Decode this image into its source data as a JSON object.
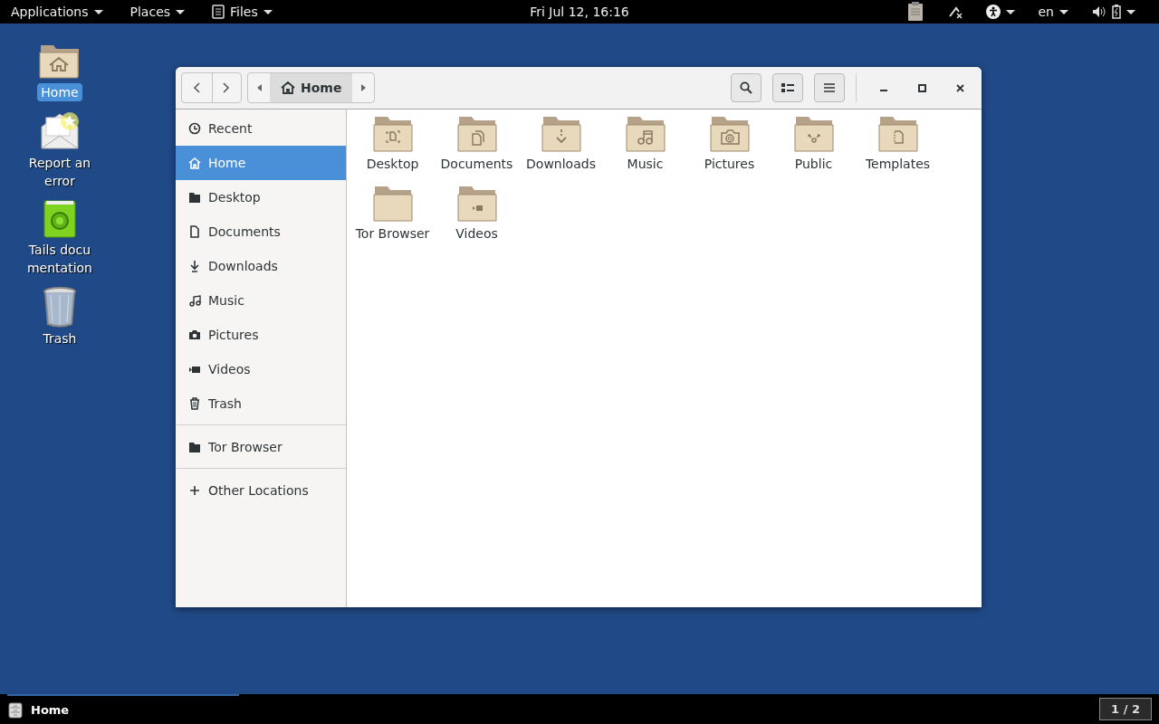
{
  "top_bar": {
    "menus": [
      {
        "label": "Applications",
        "kind": "menu"
      },
      {
        "label": "Places",
        "kind": "menu"
      },
      {
        "label": "Files",
        "kind": "app"
      }
    ],
    "clock": "Fri Jul 12, 16:16",
    "language": "en"
  },
  "desktop_icons": [
    {
      "label": "Home",
      "kind": "home",
      "selected": true
    },
    {
      "label": "Report an error",
      "kind": "report",
      "selected": false
    },
    {
      "label": "Tails documentation",
      "kind": "book",
      "selected": false
    },
    {
      "label": "Trash",
      "kind": "trash",
      "selected": false
    }
  ],
  "window": {
    "path_bar": [
      {
        "label": "Home",
        "selected": true
      }
    ],
    "sidebar": {
      "sections": [
        [
          {
            "label": "Recent",
            "kind": "recent",
            "selected": false
          },
          {
            "label": "Home",
            "kind": "home",
            "selected": true
          },
          {
            "label": "Desktop",
            "kind": "folder",
            "selected": false
          },
          {
            "label": "Documents",
            "kind": "document",
            "selected": false
          },
          {
            "label": "Downloads",
            "kind": "download",
            "selected": false
          },
          {
            "label": "Music",
            "kind": "music",
            "selected": false
          },
          {
            "label": "Pictures",
            "kind": "camera",
            "selected": false
          },
          {
            "label": "Videos",
            "kind": "video",
            "selected": false
          },
          {
            "label": "Trash",
            "kind": "trash",
            "selected": false
          }
        ],
        [
          {
            "label": "Tor Browser",
            "kind": "folder",
            "selected": false
          }
        ],
        [
          {
            "label": "Other Locations",
            "kind": "plus",
            "selected": false
          }
        ]
      ]
    },
    "files": [
      {
        "label": "Desktop",
        "kind": "desktop"
      },
      {
        "label": "Documents",
        "kind": "documents"
      },
      {
        "label": "Downloads",
        "kind": "downloads"
      },
      {
        "label": "Music",
        "kind": "music"
      },
      {
        "label": "Pictures",
        "kind": "pictures"
      },
      {
        "label": "Public",
        "kind": "public"
      },
      {
        "label": "Templates",
        "kind": "templates"
      },
      {
        "label": "Tor Browser",
        "kind": "plain"
      },
      {
        "label": "Videos",
        "kind": "videos"
      }
    ]
  },
  "taskbar": {
    "tasks": [
      {
        "label": "Home",
        "selected": true
      }
    ],
    "workspace": "1 / 2"
  }
}
